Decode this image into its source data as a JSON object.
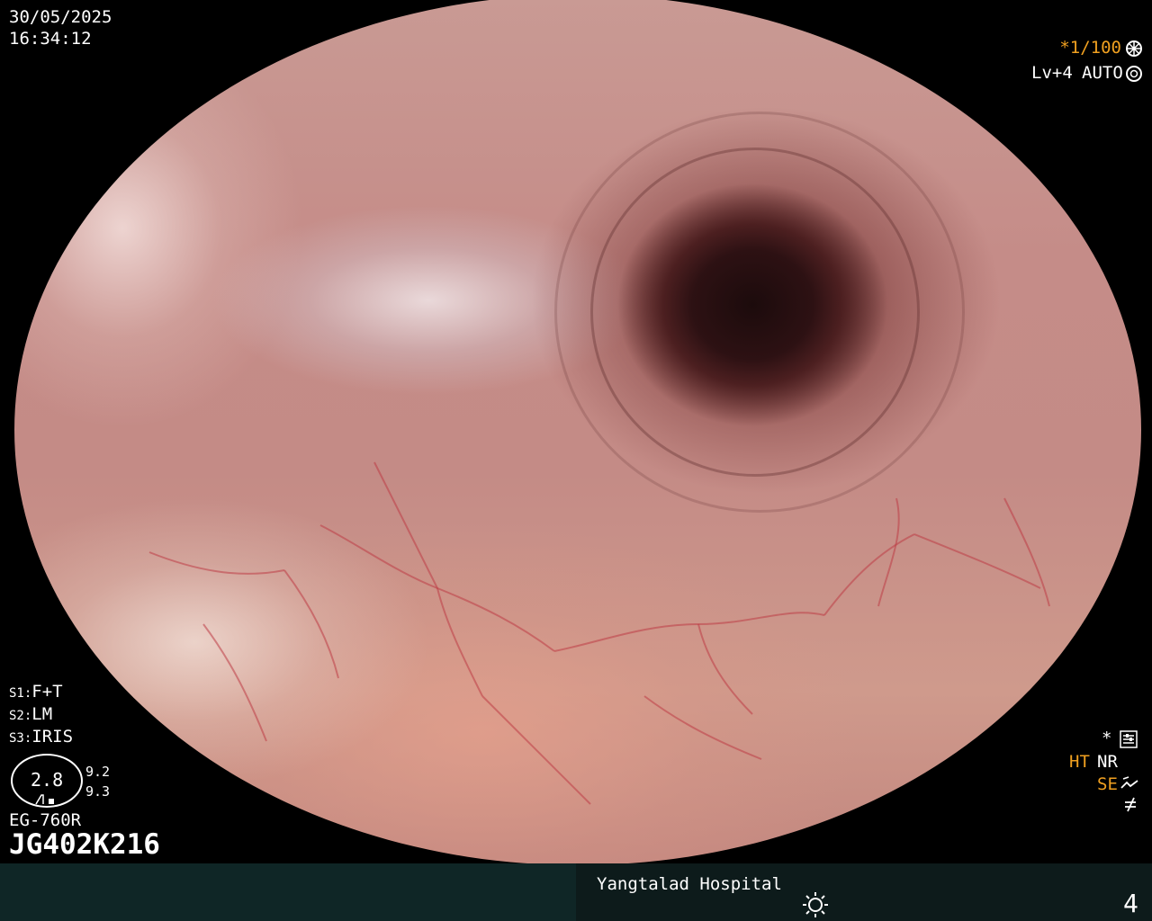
{
  "top_left": {
    "date": "30/05/2025",
    "time": "16:34:12"
  },
  "top_right": {
    "shutter": "*1/100",
    "shutter_icon": "aperture-icon",
    "level": "Lv+4",
    "mode": "AUTO",
    "mode_icon": "iris-icon"
  },
  "settings": {
    "s1": "F+T",
    "s2": "LM",
    "s3": "IRIS",
    "s1_label": "S1:",
    "s2_label": "S2:",
    "s3_label": "S3:"
  },
  "scale": {
    "main": "2.8",
    "upper": "9.2",
    "lower": "9.3"
  },
  "scope": {
    "model": "EG-760R",
    "serial": "JG402K216"
  },
  "right_panel": {
    "star": "*",
    "ht": "HT",
    "nr": "NR",
    "se": "SE",
    "settings_icon": "sliders-icon",
    "se_icon": "enhance-icon",
    "freeze_icon": "not-equal-icon"
  },
  "footer": {
    "hospital": "Yangtalad Hospital",
    "light_icon": "sun-icon",
    "page_number": "4"
  },
  "colors": {
    "footer_left": "#0f2626",
    "footer_right": "#0d1b1b",
    "accent_orange": "#f0a020"
  }
}
